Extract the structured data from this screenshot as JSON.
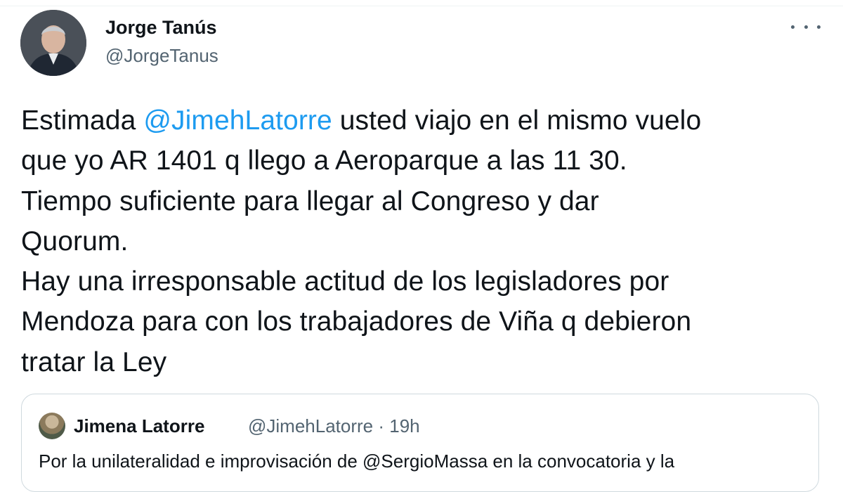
{
  "author": {
    "display_name": "Jorge Tanús",
    "handle": "@JorgeTanus"
  },
  "menu": {
    "more_icon": "more-horizontal-icon"
  },
  "tweet": {
    "lines": [
      {
        "before": "Estimada ",
        "mention": "@JimehLatorre",
        "after": " usted viajo en el mismo vuelo"
      },
      {
        "text": "que yo AR 1401 q llego a Aeroparque a las 11 30."
      },
      {
        "text": "Tiempo suficiente para llegar al Congreso y dar"
      },
      {
        "text": "Quorum."
      },
      {
        "text": "Hay una irresponsable actitud de los legisladores por"
      },
      {
        "text": "Mendoza para con los trabajadores de Viña q debieron"
      },
      {
        "text": "tratar la Ley"
      }
    ]
  },
  "quote": {
    "display_name": "Jimena Latorre",
    "handle_time": "@JimehLatorre · 19h",
    "text": "Por la unilateralidad e improvisación de @SergioMassa  en la convocatoria y la"
  },
  "colors": {
    "text": "#0f1419",
    "secondary": "#536471",
    "link": "#1d9bf0",
    "border": "#cfd9de"
  }
}
